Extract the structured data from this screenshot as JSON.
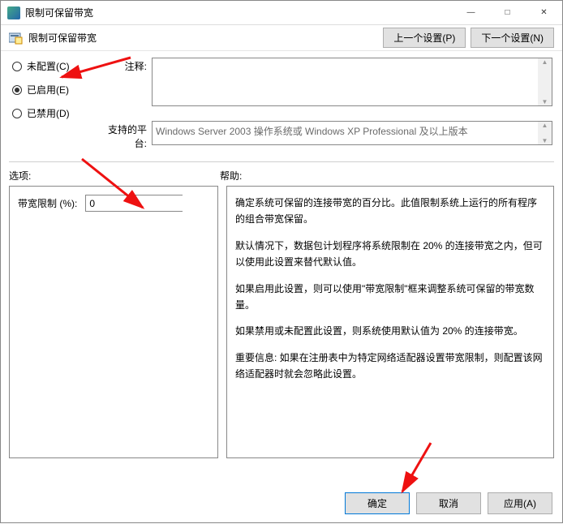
{
  "titlebar": {
    "title": "限制可保留带宽"
  },
  "toolbar": {
    "subtitle": "限制可保留带宽",
    "prev_btn": "上一个设置(P)",
    "next_btn": "下一个设置(N)"
  },
  "radios": {
    "not_configured": "未配置(C)",
    "enabled": "已启用(E)",
    "disabled": "已禁用(D)"
  },
  "labels": {
    "comment": "注释:",
    "platform": "支持的平台:",
    "options": "选项:",
    "help": "帮助:",
    "bandwidth_limit": "带宽限制 (%):"
  },
  "values": {
    "comment": "",
    "platform": "Windows Server 2003 操作系统或 Windows XP Professional 及以上版本",
    "bandwidth_limit": "0"
  },
  "help_text": {
    "p1": "确定系统可保留的连接带宽的百分比。此值限制系统上运行的所有程序的组合带宽保留。",
    "p2": "默认情况下，数据包计划程序将系统限制在 20% 的连接带宽之内，但可以使用此设置来替代默认值。",
    "p3": "如果启用此设置，则可以使用\"带宽限制\"框来调整系统可保留的带宽数量。",
    "p4": "如果禁用或未配置此设置，则系统使用默认值为 20% 的连接带宽。",
    "p5": "重要信息: 如果在注册表中为特定网络适配器设置带宽限制，则配置该网络适配器时就会忽略此设置。"
  },
  "buttons": {
    "ok": "确定",
    "cancel": "取消",
    "apply": "应用(A)"
  }
}
